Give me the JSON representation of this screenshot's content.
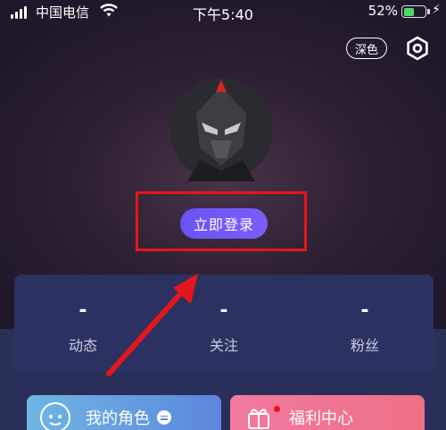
{
  "status_bar": {
    "carrier": "中国电信",
    "time": "下午5:40",
    "battery_percent": "52%",
    "battery_level": 0.52
  },
  "header": {
    "dark_mode_label": "深色"
  },
  "login": {
    "button_label": "立即登录"
  },
  "stats": [
    {
      "value": "-",
      "label": "动态"
    },
    {
      "value": "-",
      "label": "关注"
    },
    {
      "value": "-",
      "label": "粉丝"
    }
  ],
  "features": {
    "my_role_label": "我的角色",
    "welfare_label": "福利中心"
  },
  "colors": {
    "accent": "#6a54f5",
    "highlight": "#e4161c",
    "card": "#2b3160"
  }
}
